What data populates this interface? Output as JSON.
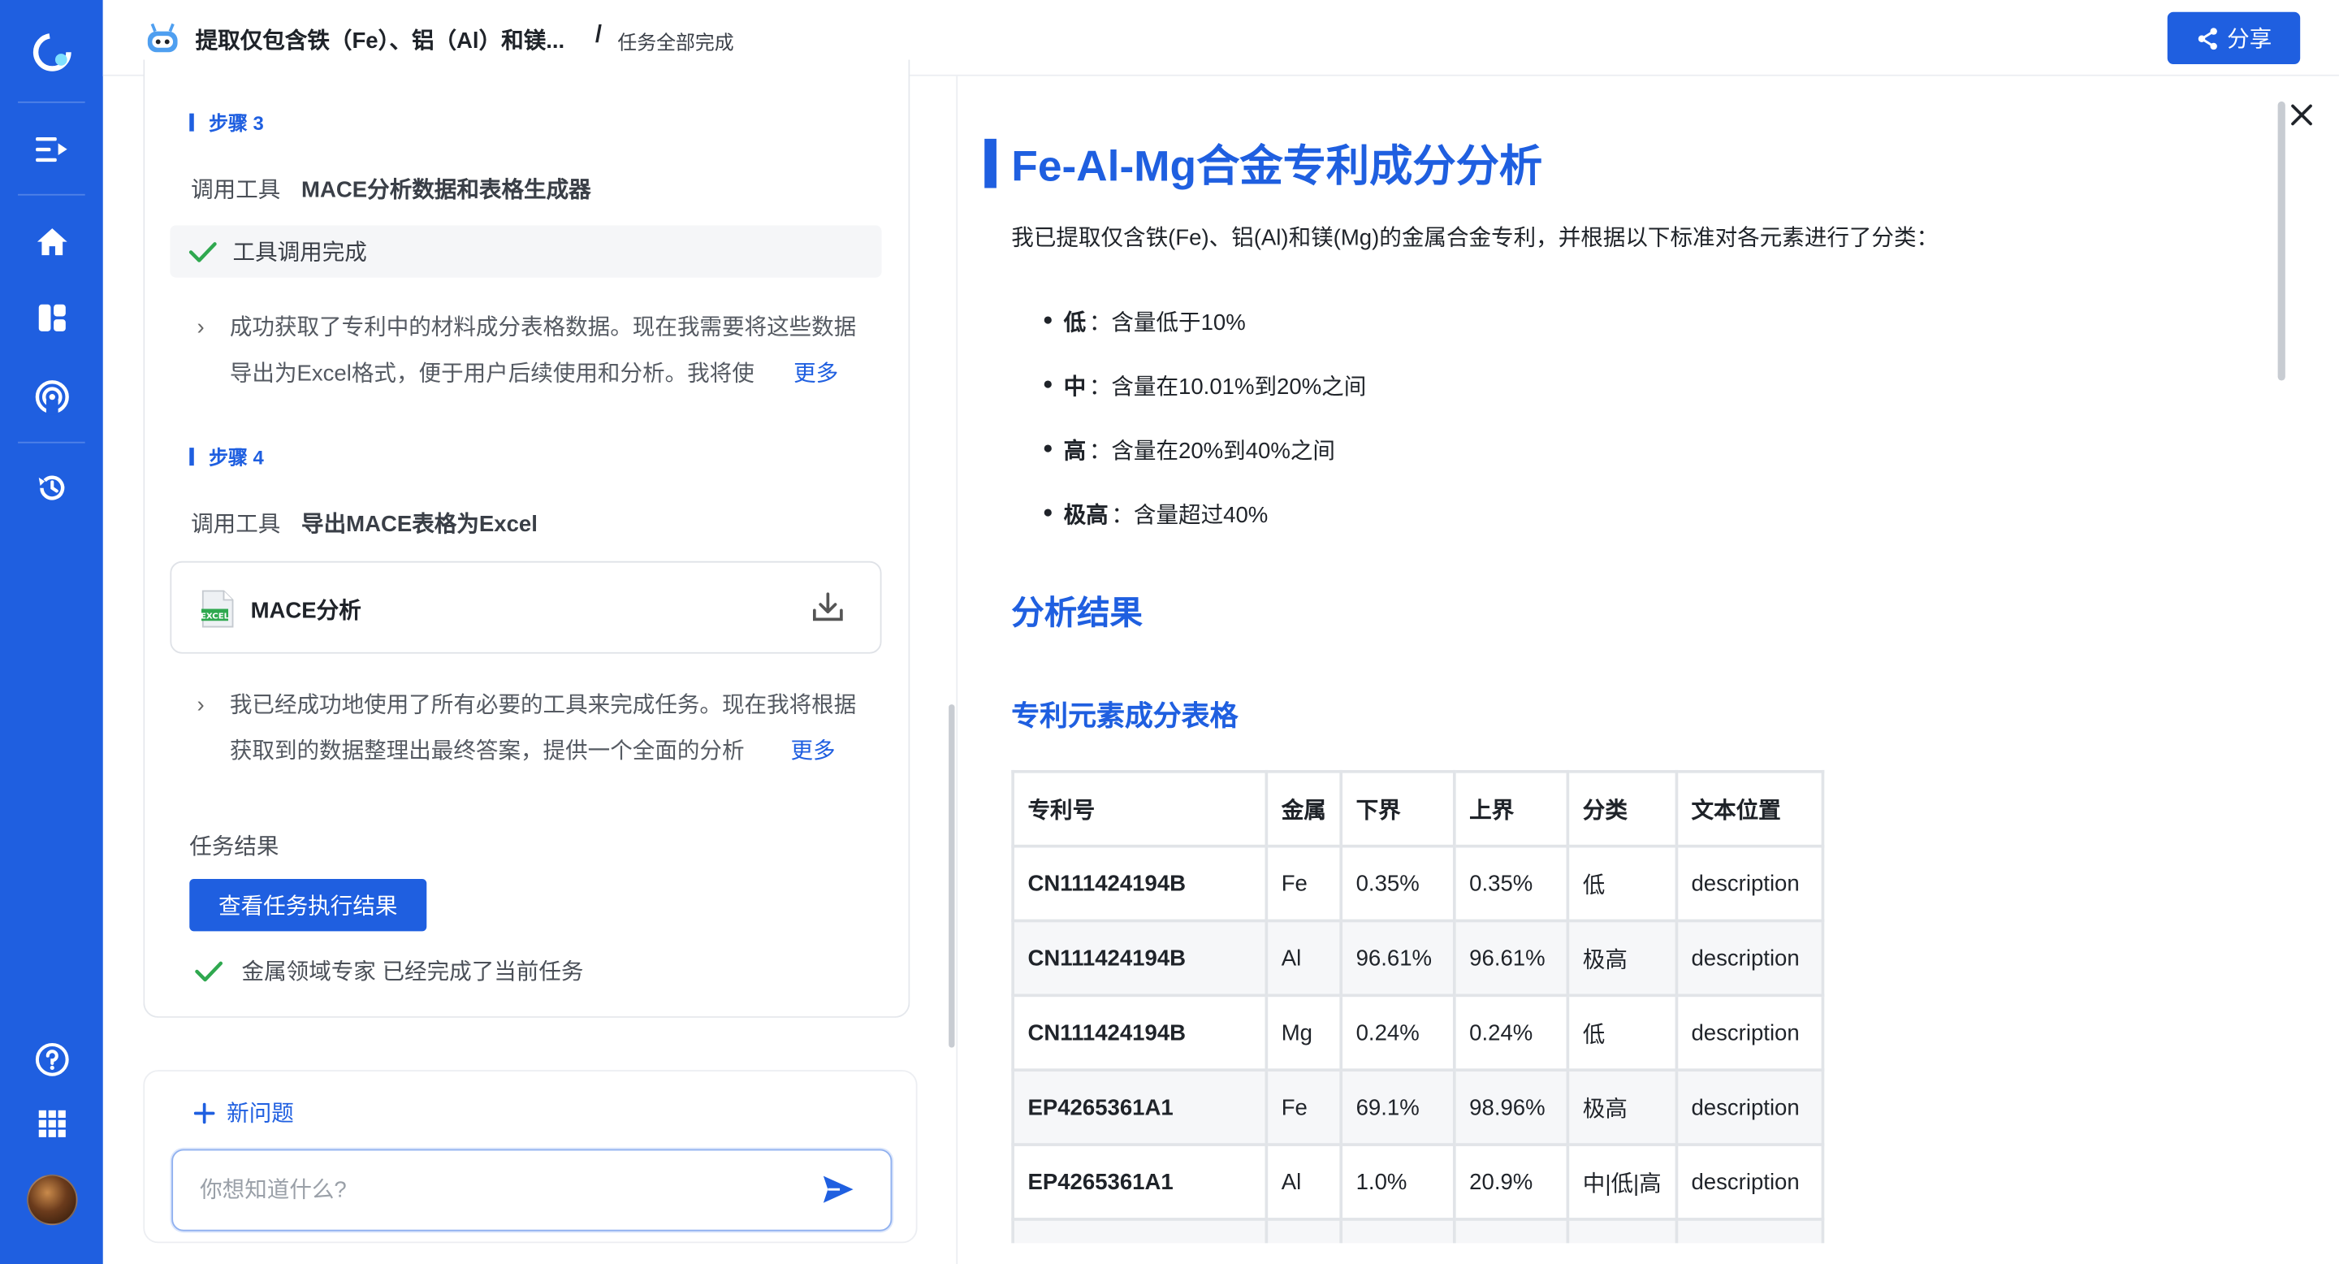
{
  "header": {
    "title": "提取仅包含铁（Fe）、铝（Al）和镁...",
    "separator": "/",
    "status": "任务全部完成",
    "share_label": "分享"
  },
  "sidebar": {
    "items": [
      {
        "name": "logo-icon"
      },
      {
        "name": "menu-expand-icon"
      },
      {
        "name": "home-icon"
      },
      {
        "name": "dashboard-icon"
      },
      {
        "name": "broadcast-icon"
      },
      {
        "name": "history-icon"
      },
      {
        "name": "help-icon"
      },
      {
        "name": "apps-grid-icon"
      },
      {
        "name": "avatar"
      }
    ]
  },
  "left": {
    "step3": {
      "label": "步骤 3",
      "tool_prefix": "调用工具",
      "tool_name": "MACE分析数据和表格生成器",
      "done_text": "工具调用完成",
      "thought_text": "成功获取了专利中的材料成分表格数据。现在我需要将这些数据导出为Excel格式，便于用户后续使用和分析。我将使",
      "more": "更多"
    },
    "step4": {
      "label": "步骤 4",
      "tool_prefix": "调用工具",
      "tool_name": "导出MACE表格为Excel",
      "file_name": "MACE分析",
      "file_badge": "EXCEL",
      "thought_text": "我已经成功地使用了所有必要的工具来完成任务。现在我将根据获取到的数据整理出最终答案，提供一个全面的分析",
      "more": "更多"
    },
    "result_label": "任务结果",
    "result_button": "查看任务执行结果",
    "complete_text": "金属领域专家 已经完成了当前任务"
  },
  "input": {
    "new_question": "新问题",
    "placeholder": "你想知道什么?"
  },
  "doc": {
    "title": "Fe-Al-Mg合金专利成分分析",
    "intro": "我已提取仅含铁(Fe)、铝(Al)和镁(Mg)的金属合金专利，并根据以下标准对各元素进行了分类：",
    "criteria": [
      {
        "level": "低",
        "desc": "：含量低于10%"
      },
      {
        "level": "中",
        "desc": "：含量在10.01%到20%之间"
      },
      {
        "level": "高",
        "desc": "：含量在20%到40%之间"
      },
      {
        "level": "极高",
        "desc": "：含量超过40%"
      }
    ],
    "h2": "分析结果",
    "h3": "专利元素成分表格",
    "table": {
      "headers": [
        "专利号",
        "金属",
        "下界",
        "上界",
        "分类",
        "文本位置"
      ],
      "rows": [
        [
          "CN111424194B",
          "Fe",
          "0.35%",
          "0.35%",
          "低",
          "description"
        ],
        [
          "CN111424194B",
          "Al",
          "96.61%",
          "96.61%",
          "极高",
          "description"
        ],
        [
          "CN111424194B",
          "Mg",
          "0.24%",
          "0.24%",
          "低",
          "description"
        ],
        [
          "EP4265361A1",
          "Fe",
          "69.1%",
          "98.96%",
          "极高",
          "description"
        ],
        [
          "EP4265361A1",
          "Al",
          "1.0%",
          "20.9%",
          "中|低|高",
          "description"
        ]
      ]
    }
  },
  "colors": {
    "primary": "#1f5fe0",
    "success": "#2fa84f"
  }
}
